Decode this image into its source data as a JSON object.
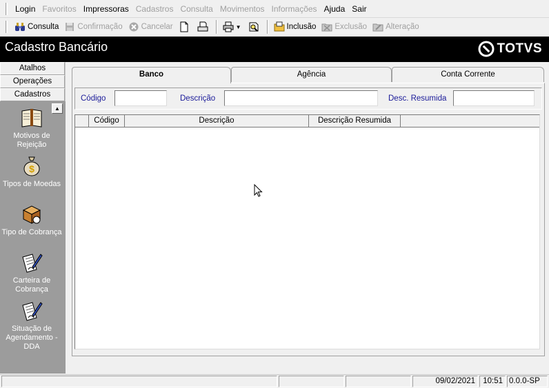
{
  "menu": {
    "items": [
      {
        "label": "Login",
        "enabled": true
      },
      {
        "label": "Favoritos",
        "enabled": false
      },
      {
        "label": "Impressoras",
        "enabled": true
      },
      {
        "label": "Cadastros",
        "enabled": false
      },
      {
        "label": "Consulta",
        "enabled": false
      },
      {
        "label": "Movimentos",
        "enabled": false
      },
      {
        "label": "Informações",
        "enabled": false
      },
      {
        "label": "Ajuda",
        "enabled": true
      },
      {
        "label": "Sair",
        "enabled": true
      }
    ]
  },
  "toolbar": {
    "consulta": "Consulta",
    "confirmacao": "Confirmação",
    "cancelar": "Cancelar",
    "inclusao": "Inclusão",
    "exclusao": "Exclusão",
    "alteracao": "Alteração"
  },
  "header": {
    "title": "Cadastro Bancário",
    "brand": "TOTVS"
  },
  "leftpanel": {
    "tabs": [
      "Atalhos",
      "Operações",
      "Cadastros"
    ],
    "items": [
      {
        "label": "Motivos de Rejeição",
        "icon": "book-icon"
      },
      {
        "label": "Tipos de Moedas",
        "icon": "money-bag-icon"
      },
      {
        "label": "Tipo de Cobrança",
        "icon": "box-icon"
      },
      {
        "label": "Carteira de Cobrança",
        "icon": "documents-pen-icon"
      },
      {
        "label": "Situação de Agendamento - DDA",
        "icon": "documents-pen-icon"
      }
    ]
  },
  "main": {
    "tabs": [
      {
        "label": "Banco",
        "active": true
      },
      {
        "label": "Agência",
        "active": false
      },
      {
        "label": "Conta Corrente",
        "active": false
      }
    ],
    "filters": {
      "codigo_label": "Código",
      "codigo_value": "",
      "descricao_label": "Descrição",
      "descricao_value": "",
      "desc_resumida_label": "Desc. Resumida",
      "desc_resumida_value": ""
    },
    "grid": {
      "columns": [
        "",
        "Código",
        "Descrição",
        "Descrição Resumida",
        ""
      ],
      "rows": []
    }
  },
  "status": {
    "date": "09/02/2021",
    "time": "10:51",
    "version": "0.0.0-SP"
  },
  "colors": {
    "label_blue": "#1a1a99",
    "panel_gray": "#9c9c9c",
    "title_bg": "#000000"
  }
}
